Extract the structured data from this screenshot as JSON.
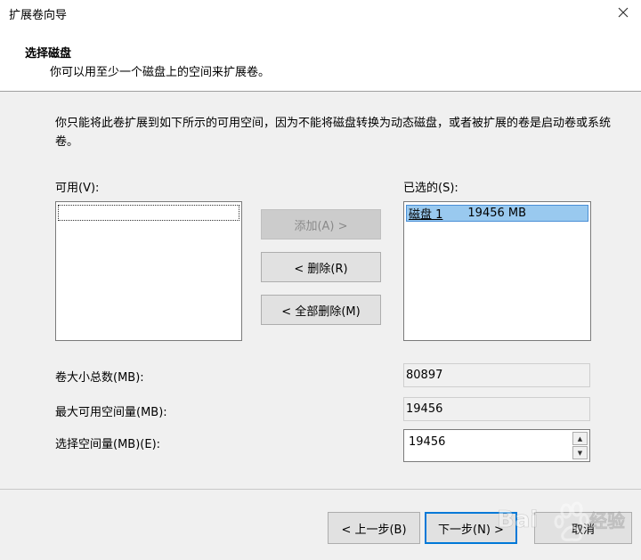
{
  "window": {
    "title": "扩展卷向导",
    "close_icon": "close-icon"
  },
  "header": {
    "title": "选择磁盘",
    "subtitle": "你可以用至少一个磁盘上的空间来扩展卷。"
  },
  "description": "你只能将此卷扩展到如下所示的可用空间，因为不能将磁盘转换为动态磁盘，或者被扩展的卷是启动卷或系统卷。",
  "available": {
    "label": "可用(V):",
    "items": []
  },
  "selected": {
    "label": "已选的(S):",
    "items": [
      {
        "disk": "磁盘 1",
        "size": "19456 MB"
      }
    ]
  },
  "buttons": {
    "add": "添加(A) >",
    "remove": "< 删除(R)",
    "remove_all": "< 全部删除(M)",
    "back": "< 上一步(B)",
    "next": "下一步(N) >",
    "cancel": "取消"
  },
  "fields": {
    "total_label": "卷大小总数(MB):",
    "total_value": "80897",
    "max_label": "最大可用空间量(MB):",
    "max_value": "19456",
    "select_label": "选择空间量(MB)(E):",
    "select_value": "19456"
  },
  "watermark": {
    "text": "Baidu经验"
  }
}
